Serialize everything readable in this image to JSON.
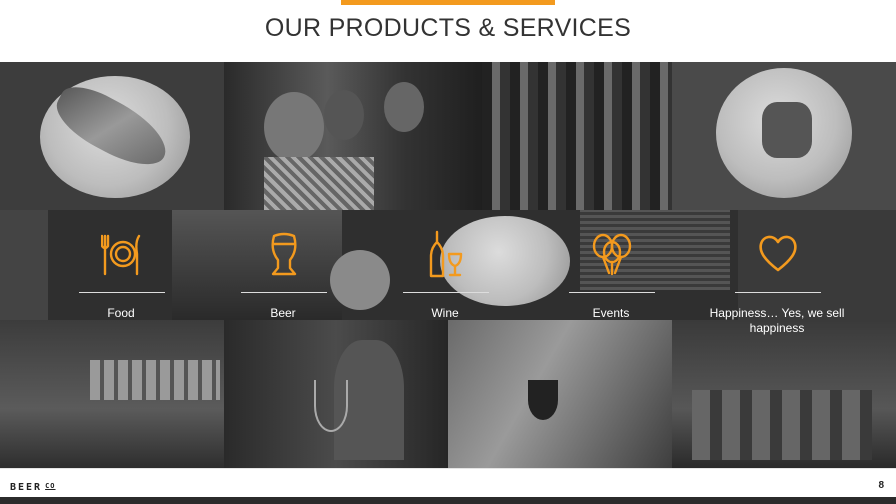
{
  "slide": {
    "title": "OUR PRODUCTS & SERVICES",
    "page_number": "8",
    "accent_color": "#f39a1e"
  },
  "logo": {
    "text": "BEER",
    "suffix": "CO"
  },
  "services": [
    {
      "label": "Food",
      "icon": "plate-fork-knife-icon"
    },
    {
      "label": "Beer",
      "icon": "beer-glass-icon"
    },
    {
      "label": "Wine",
      "icon": "wine-bottle-glass-icon"
    },
    {
      "label": "Events",
      "icon": "balloons-icon"
    },
    {
      "label": "Happiness… Yes, we sell happiness",
      "icon": "heart-icon"
    }
  ]
}
